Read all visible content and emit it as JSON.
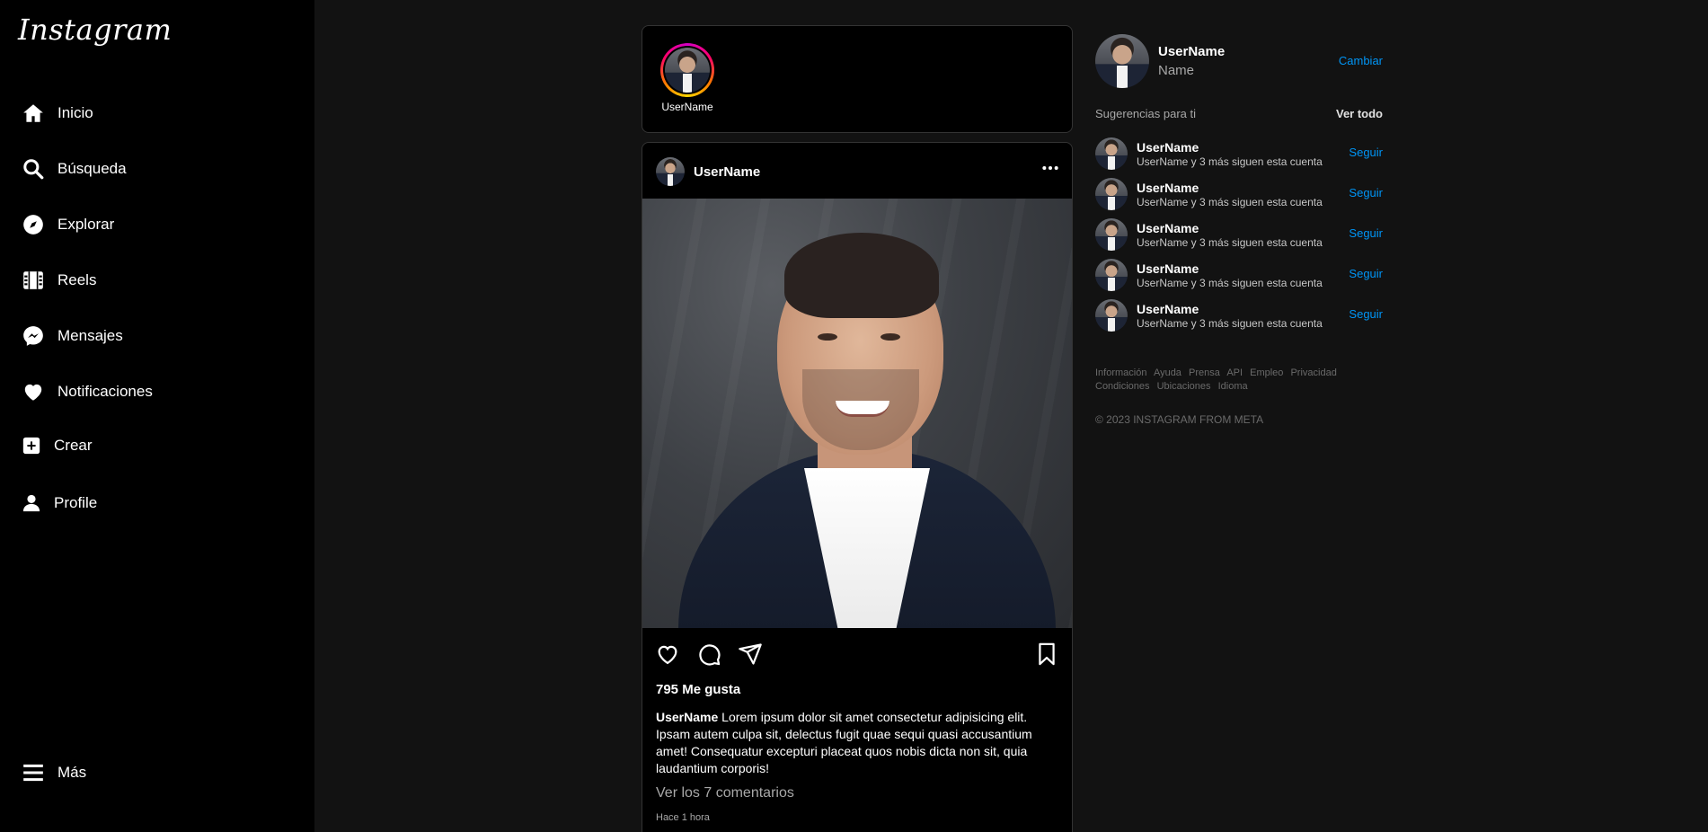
{
  "app": {
    "logo_text": "Instagram"
  },
  "sidebar": {
    "items": [
      {
        "label": "Inicio",
        "icon": "home-icon"
      },
      {
        "label": "Búsqueda",
        "icon": "search-icon"
      },
      {
        "label": "Explorar",
        "icon": "compass-icon"
      },
      {
        "label": "Reels",
        "icon": "reels-icon"
      },
      {
        "label": "Mensajes",
        "icon": "messenger-icon"
      },
      {
        "label": "Notificaciones",
        "icon": "heart-icon"
      },
      {
        "label": "Crear",
        "icon": "plus-square-icon"
      },
      {
        "label": "Profile",
        "icon": "user-icon"
      }
    ],
    "more": {
      "label": "Más",
      "icon": "menu-icon"
    }
  },
  "stories": [
    {
      "username": "UserName"
    }
  ],
  "post": {
    "username": "UserName",
    "likes": "795 Me gusta",
    "caption_user": "UserName",
    "caption_text": " Lorem ipsum dolor sit amet consectetur adipisicing elit. Ipsam autem culpa sit, delectus fugit quae sequi quasi accusantium amet! Consequatur excepturi placeat quos nobis dicta non sit, quia laudantium corporis!",
    "comments_link": "Ver los 7 comentarios",
    "time": "Hace 1 hora"
  },
  "right": {
    "me": {
      "username": "UserName",
      "name": "Name",
      "switch": "Cambiar"
    },
    "suggestions_title": "Sugerencias para ti",
    "see_all": "Ver todo",
    "suggestions": [
      {
        "username": "UserName",
        "sub": "UserName y 3 más siguen esta cuenta",
        "action": "Seguir"
      },
      {
        "username": "UserName",
        "sub": "UserName y 3 más siguen esta cuenta",
        "action": "Seguir"
      },
      {
        "username": "UserName",
        "sub": "UserName y 3 más siguen esta cuenta",
        "action": "Seguir"
      },
      {
        "username": "UserName",
        "sub": "UserName y 3 más siguen esta cuenta",
        "action": "Seguir"
      },
      {
        "username": "UserName",
        "sub": "UserName y 3 más siguen esta cuenta",
        "action": "Seguir"
      }
    ],
    "footer_links": [
      "Información",
      "Ayuda",
      "Prensa",
      "API",
      "Empleo",
      "Privacidad",
      "Condiciones",
      "Ubicaciones",
      "Idioma"
    ],
    "copyright": "© 2023 INSTAGRAM FROM META"
  },
  "colors": {
    "accent": "#0095f6",
    "background": "#121212",
    "panel": "#000000"
  }
}
